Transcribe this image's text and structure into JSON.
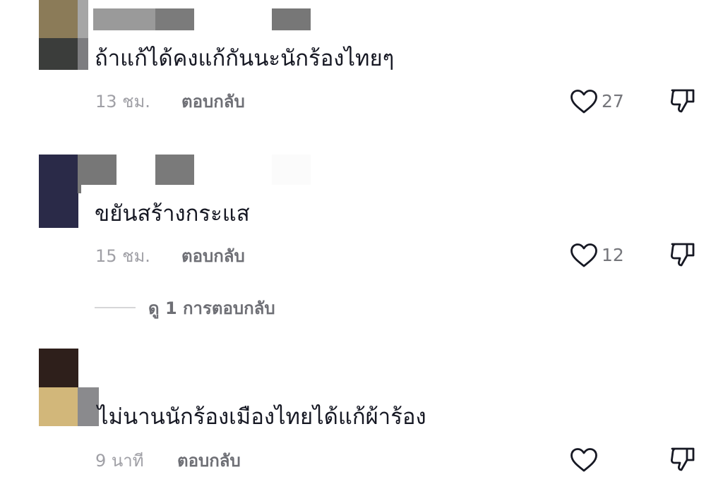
{
  "comments": [
    {
      "text": "ถ้าแก้ได้คงแก้กันนะนักร้องไทยๆ",
      "time": "13 ชม.",
      "reply_label": "ตอบกลับ",
      "likes": "27"
    },
    {
      "text": "ขยันสร้างกระแส",
      "time": "15 ชม.",
      "reply_label": "ตอบกลับ",
      "likes": "12",
      "view_replies": "ดู 1 การตอบกลับ"
    },
    {
      "text": "ไม่นานนักร้องเมืองไทยได้แก้ผ้าร้อง",
      "time": "9 นาที",
      "reply_label": "ตอบกลับ",
      "likes": ""
    }
  ],
  "icons": {
    "like": "heart-outline-icon",
    "dislike": "thumbs-down-outline-icon"
  },
  "colors": {
    "text": "#161823",
    "meta": "#a0a0a6",
    "reply": "#6e6f75",
    "icon": "#161823"
  }
}
